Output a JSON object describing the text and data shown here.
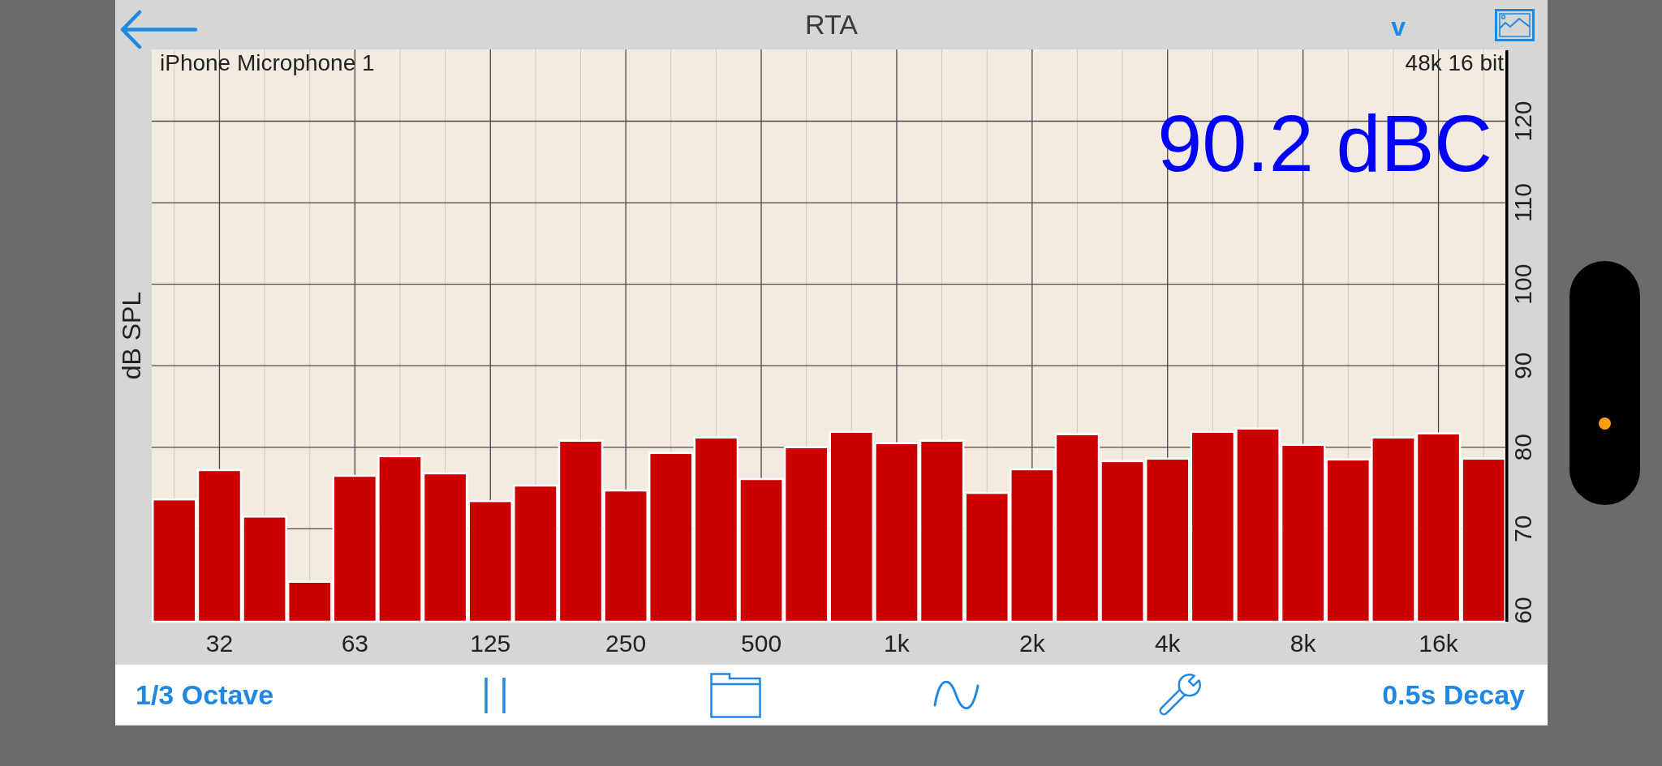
{
  "top_bar": {
    "title": "RTA",
    "menu_button": "v"
  },
  "rta": {
    "device_label": "iPhone Microphone 1",
    "format_label": "48k 16 bit",
    "level_reading": "90.2 dBC",
    "chart_data": {
      "type": "bar",
      "ylabel": "dB SPL",
      "categories": [
        null,
        "32",
        null,
        null,
        "63",
        null,
        null,
        "125",
        null,
        null,
        "250",
        null,
        null,
        "500",
        null,
        null,
        "1k",
        null,
        null,
        "2k",
        null,
        null,
        "4k",
        null,
        null,
        "8k",
        null,
        null,
        "16k",
        null
      ],
      "values": [
        73.6,
        77.2,
        71.5,
        63.5,
        76.5,
        78.9,
        76.8,
        73.4,
        75.3,
        80.8,
        74.7,
        79.3,
        81.2,
        76.1,
        80.0,
        81.9,
        80.5,
        80.8,
        74.4,
        77.3,
        81.6,
        78.3,
        78.6,
        81.9,
        82.3,
        80.3,
        78.5,
        81.2,
        81.7,
        78.6
      ],
      "ylim": [
        58.6,
        128.8
      ],
      "yticks": [
        60,
        70,
        80,
        90,
        100,
        110,
        120
      ],
      "grid": true
    }
  },
  "toolbar": {
    "resolution_button": "1/3 Octave",
    "decay_button": "0.5s Decay"
  }
}
